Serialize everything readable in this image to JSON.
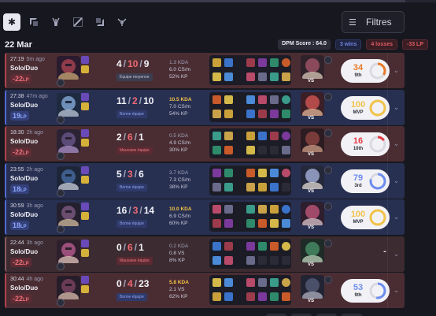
{
  "filters": {
    "tabs": [
      {
        "name": "all",
        "icon": "asterisk-icon"
      },
      {
        "name": "top",
        "icon": "top-lane-icon"
      },
      {
        "name": "jungle",
        "icon": "jungle-icon"
      },
      {
        "name": "mid",
        "icon": "mid-lane-icon"
      },
      {
        "name": "bot",
        "icon": "bot-lane-icon"
      },
      {
        "name": "support",
        "icon": "support-icon"
      }
    ],
    "button_label": "Filtres"
  },
  "summary": {
    "date": "22 Mar",
    "dpm": "DPM Score : 64.0",
    "wins": "3 wins",
    "losses": "4 losses",
    "lp": "-33 LP"
  },
  "games": [
    {
      "result": "loss",
      "time": "27:19",
      "ago": "5m ago",
      "queue": "Solo/Duo",
      "lp": "-22",
      "lp_unit": "LP",
      "kills": "4",
      "deaths": "10",
      "assists": "9",
      "tag": "Équipe moyenne",
      "tag_type": "avg",
      "kda": "1.3 KDA",
      "cs": "6.0 CS/m",
      "kp": "52% KP",
      "kda_highlight": false,
      "score": "34",
      "score_sub": "9th",
      "score_color": "#e67a2a",
      "score_fraction": 0.34
    },
    {
      "result": "win",
      "time": "27:38",
      "ago": "47m ago",
      "queue": "Solo/Duo",
      "lp": "19",
      "lp_unit": "LP",
      "kills": "11",
      "deaths": "2",
      "assists": "10",
      "tag": "Bonne équipe",
      "tag_type": "good",
      "kda": "10.5 KDA",
      "cs": "7.0 CS/m",
      "kp": "54% KP",
      "kda_highlight": true,
      "score": "100",
      "score_sub": "MVP",
      "score_color": "#f2c34a",
      "score_fraction": 1.0
    },
    {
      "result": "loss",
      "time": "18:30",
      "ago": "2h ago",
      "queue": "Solo/Duo",
      "lp": "-22",
      "lp_unit": "LP",
      "kills": "2",
      "deaths": "6",
      "assists": "1",
      "tag": "Mauvaise équipe",
      "tag_type": "bad",
      "kda": "0.5 KDA",
      "cs": "4.9 CS/m",
      "kp": "30% KP",
      "kda_highlight": false,
      "score": "16",
      "score_sub": "10th",
      "score_color": "#e23a44",
      "score_fraction": 0.16
    },
    {
      "result": "win",
      "time": "23:55",
      "ago": "2h ago",
      "queue": "Solo/Duo",
      "lp": "18",
      "lp_unit": "LP",
      "kills": "5",
      "deaths": "3",
      "assists": "6",
      "tag": "Bonne équipe",
      "tag_type": "good",
      "kda": "3.7 KDA",
      "cs": "7.3 CS/m",
      "kp": "38% KP",
      "kda_highlight": false,
      "score": "79",
      "score_sub": "3rd",
      "score_color": "#6d8cf0",
      "score_fraction": 0.79
    },
    {
      "result": "win",
      "time": "30:59",
      "ago": "3h ago",
      "queue": "Solo/Duo",
      "lp": "18",
      "lp_unit": "LP",
      "kills": "16",
      "deaths": "3",
      "assists": "14",
      "tag": "Bonne équipe",
      "tag_type": "good",
      "kda": "10.0 KDA",
      "cs": "6.9 CS/m",
      "kp": "60% KP",
      "kda_highlight": true,
      "score": "100",
      "score_sub": "MVP",
      "score_color": "#f2c34a",
      "score_fraction": 1.0
    },
    {
      "result": "remake",
      "time": "22:44",
      "ago": "3h ago",
      "queue": "Solo/Duo",
      "lp": "-22",
      "lp_unit": "LP",
      "kills": "0",
      "deaths": "6",
      "assists": "1",
      "tag": "Mauvaise équipe",
      "tag_type": "bad",
      "kda": "0.2 KDA",
      "cs": "0.8 VS",
      "kp": "8% KP",
      "kda_highlight": false,
      "score": "-",
      "score_sub": "",
      "score_color": "",
      "score_fraction": 0
    },
    {
      "result": "loss",
      "time": "30:44",
      "ago": "4h ago",
      "queue": "Solo/Duo",
      "lp": "-22",
      "lp_unit": "LP",
      "kills": "0",
      "deaths": "4",
      "assists": "23",
      "tag": "Bonne équipe",
      "tag_type": "good",
      "kda": "5.8 KDA",
      "cs": "2.1 VS",
      "kp": "62% KP",
      "kda_highlight": true,
      "score": "53",
      "score_sub": "9th",
      "score_color": "#6d8cf0",
      "score_fraction": 0.53
    }
  ]
}
